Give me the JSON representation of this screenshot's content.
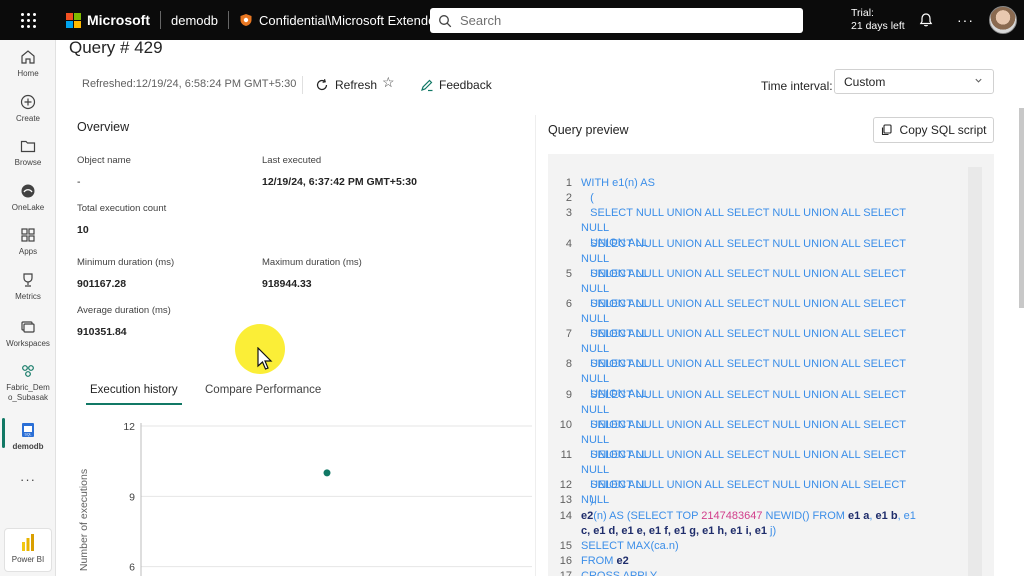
{
  "topbar": {
    "brand": "Microsoft",
    "workspace": "demodb",
    "sensitivity_label": "Confidential\\Microsoft Extended",
    "search_placeholder": "Search",
    "trial_line1": "Trial:",
    "trial_line2": "21 days left",
    "more": "···"
  },
  "rail": {
    "items": [
      {
        "label": "Home",
        "icon": "home-icon"
      },
      {
        "label": "Create",
        "icon": "create-icon"
      },
      {
        "label": "Browse",
        "icon": "browse-icon"
      },
      {
        "label": "OneLake",
        "icon": "onelake-icon"
      },
      {
        "label": "Apps",
        "icon": "apps-icon"
      },
      {
        "label": "Metrics",
        "icon": "metrics-icon"
      },
      {
        "label": "Workspaces",
        "icon": "workspaces-icon"
      },
      {
        "label": "Fabric_Demo_Subasak",
        "icon": "fabric-workspace-icon"
      },
      {
        "label": "demodb",
        "icon": "database-icon"
      }
    ],
    "more": "···",
    "bottom_label": "Power BI"
  },
  "page": {
    "title": "Query # 429",
    "refreshed": "Refreshed:12/19/24, 6:58:24 PM GMT+5:30",
    "refresh_label": "Refresh",
    "feedback_label": "Feedback",
    "time_interval_label": "Time interval:",
    "time_interval_value": "Custom"
  },
  "overview": {
    "title": "Overview",
    "object_name_label": "Object name",
    "object_name_value": "-",
    "last_executed_label": "Last executed",
    "last_executed_value": "12/19/24, 6:37:42 PM GMT+5:30",
    "total_exec_label": "Total execution count",
    "total_exec_value": "10",
    "min_duration_label": "Minimum duration (ms)",
    "min_duration_value": "901167.28",
    "max_duration_label": "Maximum duration (ms)",
    "max_duration_value": "918944.33",
    "avg_duration_label": "Average duration (ms)",
    "avg_duration_value": "910351.84"
  },
  "tabs": {
    "execution_history": "Execution history",
    "compare_performance": "Compare Performance"
  },
  "chart_data": {
    "type": "scatter",
    "ylabel": "Number of executions",
    "yticks": [
      "12",
      "9",
      "6"
    ],
    "ylim": [
      3,
      12
    ],
    "points": [
      {
        "y": 10
      }
    ],
    "grid": true
  },
  "query_preview": {
    "title": "Query preview",
    "copy_label": "Copy SQL script",
    "lines": [
      {
        "n": "1",
        "t": "WITH e1(n) AS"
      },
      {
        "n": "2",
        "t": "("
      },
      {
        "n": "3",
        "t": "SELECT NULL UNION ALL SELECT NULL UNION ALL SELECT NULL",
        "t2": "UNION ALL"
      },
      {
        "n": "4",
        "t": "SELECT NULL UNION ALL SELECT NULL UNION ALL SELECT NULL",
        "t2": "UNION ALL"
      },
      {
        "n": "5",
        "t": "SELECT NULL UNION ALL SELECT NULL UNION ALL SELECT NULL",
        "t2": "UNION ALL"
      },
      {
        "n": "6",
        "t": "SELECT NULL UNION ALL SELECT NULL UNION ALL SELECT NULL",
        "t2": "UNION ALL"
      },
      {
        "n": "7",
        "t": "SELECT NULL UNION ALL SELECT NULL UNION ALL SELECT NULL",
        "t2": "UNION ALL"
      },
      {
        "n": "8",
        "t": "SELECT NULL UNION ALL SELECT NULL UNION ALL SELECT NULL",
        "t2": "UNION ALL"
      },
      {
        "n": "9",
        "t": "SELECT NULL UNION ALL SELECT NULL UNION ALL SELECT NULL",
        "t2": "UNION ALL"
      },
      {
        "n": "10",
        "t": "SELECT NULL UNION ALL SELECT NULL UNION ALL SELECT NULL",
        "t2": "UNION ALL"
      },
      {
        "n": "11",
        "t": "SELECT NULL UNION ALL SELECT NULL UNION ALL SELECT NULL",
        "t2": "UNION ALL"
      },
      {
        "n": "12",
        "t": "SELECT NULL UNION ALL SELECT NULL UNION ALL SELECT NULL"
      },
      {
        "n": "13",
        "t": "),"
      },
      {
        "n": "14",
        "t": "e2(n) AS (SELECT TOP 2147483647 NEWID() FROM e1 a, e1 b, e1",
        "t2": "c, e1 d, e1 e, e1 f, e1 g, e1 h, e1 i, e1 j)"
      },
      {
        "n": "15",
        "t": "SELECT MAX(ca.n)"
      },
      {
        "n": "16",
        "t": "FROM e2"
      },
      {
        "n": "17",
        "t": "CROSS APPLY"
      }
    ]
  },
  "colors": {
    "accent": "#117865",
    "topbar": "#0b0b0b",
    "sql_keyword": "#3b8ee8",
    "sql_identifier": "#1f2d6b",
    "sql_number": "#d13d8a"
  }
}
